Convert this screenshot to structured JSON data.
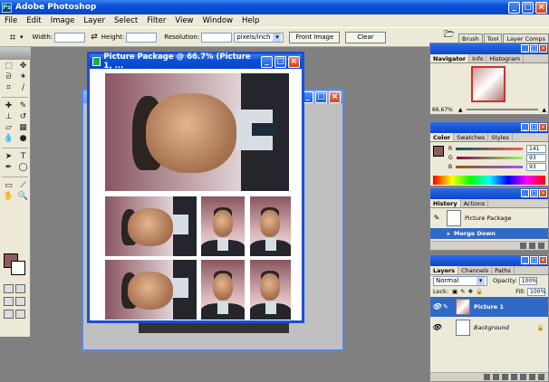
{
  "app": {
    "title": "Adobe Photoshop",
    "icon": "photoshop-icon"
  },
  "menu": [
    "File",
    "Edit",
    "Image",
    "Layer",
    "Select",
    "Filter",
    "View",
    "Window",
    "Help"
  ],
  "options": {
    "width_label": "Width:",
    "height_label": "Height:",
    "resolution_label": "Resolution:",
    "resolution_unit": "pixels/inch",
    "front_image": "Front Image",
    "clear": "Clear"
  },
  "palette_well": [
    "Brush",
    "Tool",
    "Layer Comps"
  ],
  "document": {
    "title": "Picture Package @ 66.7% (Picture  1, ..."
  },
  "navigator": {
    "tabs": [
      "Navigator",
      "Info",
      "Histogram"
    ],
    "zoom": "66.67%"
  },
  "color": {
    "tabs": [
      "Color",
      "Swatches",
      "Styles"
    ],
    "channels": [
      {
        "label": "R",
        "value": "141"
      },
      {
        "label": "G",
        "value": "93"
      },
      {
        "label": "B",
        "value": "93"
      }
    ]
  },
  "history": {
    "tabs": [
      "History",
      "Actions"
    ],
    "items": [
      "Picture Package",
      "Merge Down"
    ]
  },
  "layers": {
    "tabs": [
      "Layers",
      "Channels",
      "Paths"
    ],
    "blend_mode": "Normal",
    "opacity_label": "Opacity:",
    "opacity": "100%",
    "lock_label": "Lock:",
    "fill_label": "Fill:",
    "fill": "100%",
    "items": [
      "Picture  1",
      "Background"
    ]
  }
}
